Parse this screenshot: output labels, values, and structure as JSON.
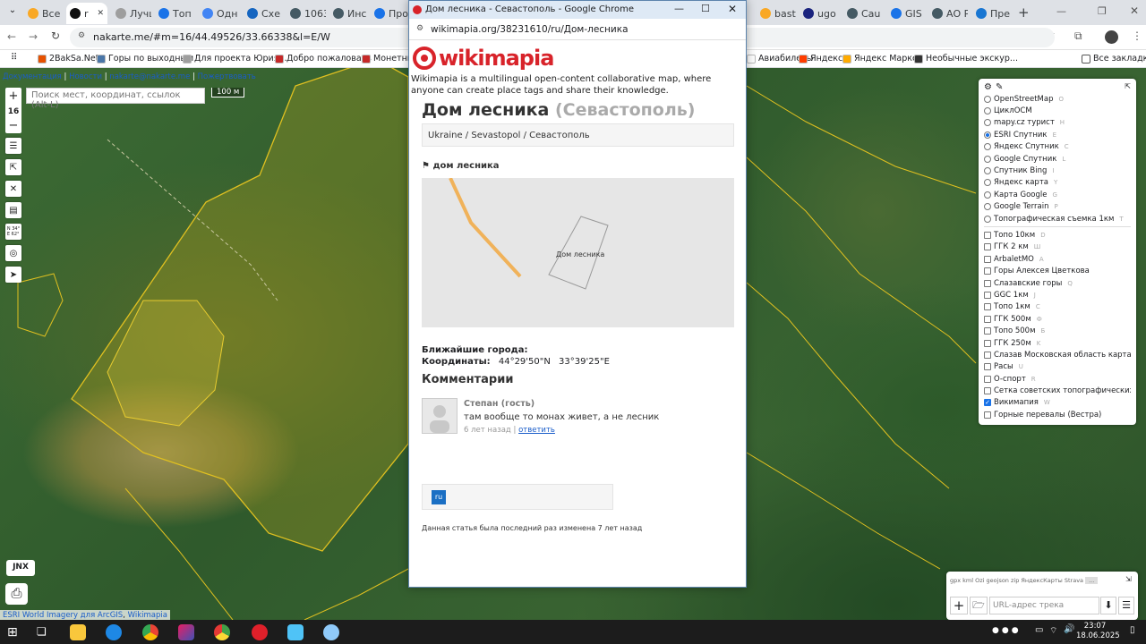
{
  "browser": {
    "tabs": [
      {
        "label": "Все с",
        "color": "#f9a825"
      },
      {
        "label": "r",
        "color": "#111111",
        "active": true
      },
      {
        "label": "Лучш",
        "color": "#9e9e9e"
      },
      {
        "label": "Топ",
        "color": "#1a73e8"
      },
      {
        "label": "Одн",
        "color": "#4285f4"
      },
      {
        "label": "Схе",
        "color": "#1565c0"
      },
      {
        "label": "1063",
        "color": "#455a64"
      },
      {
        "label": "Инс",
        "color": "#455a64"
      },
      {
        "label": "Про",
        "color": "#1a73e8"
      },
      {
        "label": "bast",
        "color": "#f9a825"
      },
      {
        "label": "ugo",
        "color": "#1a237e"
      },
      {
        "label": "Cau",
        "color": "#455a64"
      },
      {
        "label": "GIS",
        "color": "#1a73e8"
      },
      {
        "label": "АО Р",
        "color": "#455a64"
      },
      {
        "label": "Пре",
        "color": "#1976d2"
      }
    ],
    "new_tab": "+",
    "url": "nakarte.me/#m=16/44.49526/33.66338&l=E/W",
    "bookmarks": [
      {
        "label": "2BakSa.Net",
        "color": "#e65100"
      },
      {
        "label": "Горы по выходным",
        "color": "#4a76a8"
      },
      {
        "label": "Для проекта Юрия...",
        "color": "#9e9e9e"
      },
      {
        "label": "Добро пожаловать",
        "color": "#c62828"
      },
      {
        "label": "Монетный",
        "color": "#c62828"
      },
      {
        "label": "Авиабилеты",
        "color": "#ffffff"
      },
      {
        "label": "Яндекс",
        "color": "#ff3d00"
      },
      {
        "label": "Яндекс Маркет",
        "color": "#ffab00"
      },
      {
        "label": "Необычные экскур...",
        "color": "#333333"
      }
    ],
    "all_bookmarks": "Все закладки"
  },
  "map": {
    "top_links": [
      "Документация",
      "Новости",
      "nakarte@nakarte.me",
      "Пожертвовать"
    ],
    "search_placeholder": "Поиск мест, координат, ссылок (Alt-L)",
    "scale": "100 м",
    "zoom_in": "+",
    "zoom_level": "16",
    "zoom_out": "−",
    "coords_btn": "N 34°\nE 62°",
    "jnx": "JNX",
    "attribution_1": "ESRI World Imagery для ArcGIS",
    "attribution_2": "Wikimapia",
    "layers_base": [
      {
        "label": "OpenStreetMap",
        "hk": "O",
        "on": false
      },
      {
        "label": "ЦиклОСМ",
        "hk": "",
        "on": false
      },
      {
        "label": "mapy.cz турист",
        "hk": "H",
        "on": false
      },
      {
        "label": "ESRI Спутник",
        "hk": "E",
        "on": true
      },
      {
        "label": "Яндекс Спутник",
        "hk": "C",
        "on": false
      },
      {
        "label": "Google Спутник",
        "hk": "L",
        "on": false
      },
      {
        "label": "Спутник Bing",
        "hk": "I",
        "on": false
      },
      {
        "label": "Яндекс карта",
        "hk": "Y",
        "on": false
      },
      {
        "label": "Карта Google",
        "hk": "G",
        "on": false
      },
      {
        "label": "Google Terrain",
        "hk": "P",
        "on": false
      },
      {
        "label": "Топографическая съемка 1км",
        "hk": "T",
        "on": false
      }
    ],
    "layers_overlay": [
      {
        "label": "Топо 10км",
        "hk": "D",
        "on": false
      },
      {
        "label": "ГГК 2 км",
        "hk": "Ш",
        "on": false
      },
      {
        "label": "ArbaletMO",
        "hk": "A",
        "on": false
      },
      {
        "label": "Горы Алексея Цветкова",
        "hk": "",
        "on": false
      },
      {
        "label": "Слазавские горы",
        "hk": "Q",
        "on": false
      },
      {
        "label": "GGC 1км",
        "hk": "J",
        "on": false
      },
      {
        "label": "Топо 1км",
        "hk": "C",
        "on": false
      },
      {
        "label": "ГГК 500м",
        "hk": "Ф",
        "on": false
      },
      {
        "label": "Топо 500м",
        "hk": "Б",
        "on": false
      },
      {
        "label": "ГГК 250м",
        "hk": "K",
        "on": false
      },
      {
        "label": "Слазав Московская область карта",
        "hk": "Z",
        "on": false
      },
      {
        "label": "Расы",
        "hk": "U",
        "on": false
      },
      {
        "label": "O-спорт",
        "hk": "R",
        "on": false
      },
      {
        "label": "Сетка советских топографических карт",
        "hk": "",
        "on": false
      },
      {
        "label": "Викимапия",
        "hk": "W",
        "on": true
      },
      {
        "label": "Горные перевалы (Вестра)",
        "hk": "",
        "on": false
      }
    ],
    "track_links": "gpx kml Ozi geojson zip ЯндексКарты Strava",
    "track_more": "...",
    "track_placeholder": "URL-адрес трека"
  },
  "popup": {
    "window_title": "Дом лесника - Севастополь - Google Chrome",
    "url": "wikimapia.org/38231610/ru/Дом-лесника",
    "logo": "wikimapia",
    "tagline": "Wikimapia is a multilingual open-content collaborative map, where anyone can create place tags and share their knowledge.",
    "heading": "Дом лесника",
    "heading_city": "(Севастополь)",
    "breadcrumb": "Ukraine / Sevastopol / Севастополь",
    "place_tag": "дом лесника",
    "map_label": "Дом лесника",
    "nearest_cities": "Ближайшие города:",
    "coords_label": "Координаты:",
    "coords_n": "44°29'50\"N",
    "coords_e": "33°39'25\"E",
    "comments_heading": "Комментарии",
    "comment_author": "Степан (гость)",
    "comment_text": "там вообще то монах живет, а не лесник",
    "comment_time": "6 лет назад",
    "comment_reply": "ответить",
    "lang_badge": "ru",
    "last_modified": "Данная статья была последний раз изменена 7 лет назад"
  },
  "taskbar": {
    "time": "23:07",
    "date": "18.06.2025"
  }
}
